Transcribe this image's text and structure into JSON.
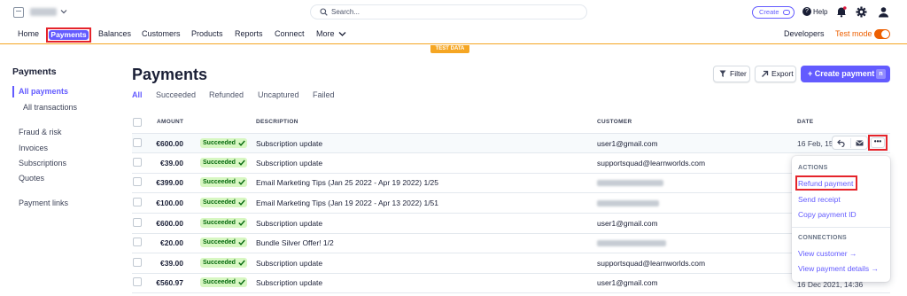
{
  "topbar": {
    "search_placeholder": "Search...",
    "create_label": "Create",
    "help_label": "Help"
  },
  "nav": {
    "items": [
      "Home",
      "Payments",
      "Balances",
      "Customers",
      "Products",
      "Reports",
      "Connect",
      "More"
    ],
    "developers": "Developers",
    "test_mode": "Test mode",
    "test_mode_on": true,
    "test_data_banner": "TEST DATA"
  },
  "sidebar": {
    "title": "Payments",
    "items": [
      "All payments",
      "All transactions",
      "Fraud & risk",
      "Invoices",
      "Subscriptions",
      "Quotes",
      "Payment links"
    ]
  },
  "main": {
    "title": "Payments",
    "filter_label": "Filter",
    "export_label": "Export",
    "create_payment_label": "+ Create payment",
    "create_payment_shortcut": "n",
    "tabs": [
      "All",
      "Succeeded",
      "Refunded",
      "Uncaptured",
      "Failed"
    ],
    "columns": [
      "AMOUNT",
      "DESCRIPTION",
      "CUSTOMER",
      "DATE"
    ],
    "rows": [
      {
        "amount": "€600.00",
        "status": "Succeeded",
        "description": "Subscription update",
        "customer": "user1@gmail.com",
        "date": "16 Feb, 15:4"
      },
      {
        "amount": "€39.00",
        "status": "Succeeded",
        "description": "Subscription update",
        "customer": "supportsquad@learnworlds.com",
        "date": ""
      },
      {
        "amount": "€399.00",
        "status": "Succeeded",
        "description": "Email Marketing Tips (Jan 25 2022 - Apr 19 2022) 1/25",
        "customer": "",
        "date": ""
      },
      {
        "amount": "€100.00",
        "status": "Succeeded",
        "description": "Email Marketing Tips (Jan 19 2022 - Apr 13 2022) 1/51",
        "customer": "",
        "date": ""
      },
      {
        "amount": "€600.00",
        "status": "Succeeded",
        "description": "Subscription update",
        "customer": "user1@gmail.com",
        "date": ""
      },
      {
        "amount": "€20.00",
        "status": "Succeeded",
        "description": "Bundle Silver Offer! 1/2",
        "customer": "",
        "date": ""
      },
      {
        "amount": "€39.00",
        "status": "Succeeded",
        "description": "Subscription update",
        "customer": "supportsquad@learnworlds.com",
        "date": ""
      },
      {
        "amount": "€560.97",
        "status": "Succeeded",
        "description": "Subscription update",
        "customer": "user1@gmail.com",
        "date": "16 Dec 2021, 14:36"
      }
    ]
  },
  "menu": {
    "actions_header": "ACTIONS",
    "refund": "Refund payment",
    "send_receipt": "Send receipt",
    "copy_id": "Copy payment ID",
    "connections_header": "CONNECTIONS",
    "view_customer": "View customer →",
    "view_details": "View payment details →"
  },
  "colors": {
    "accent": "#635bff",
    "success_bg": "#d7f7c2",
    "success_text": "#05690d",
    "test_mode": "#ed5f00",
    "highlight": "#e5242b"
  }
}
